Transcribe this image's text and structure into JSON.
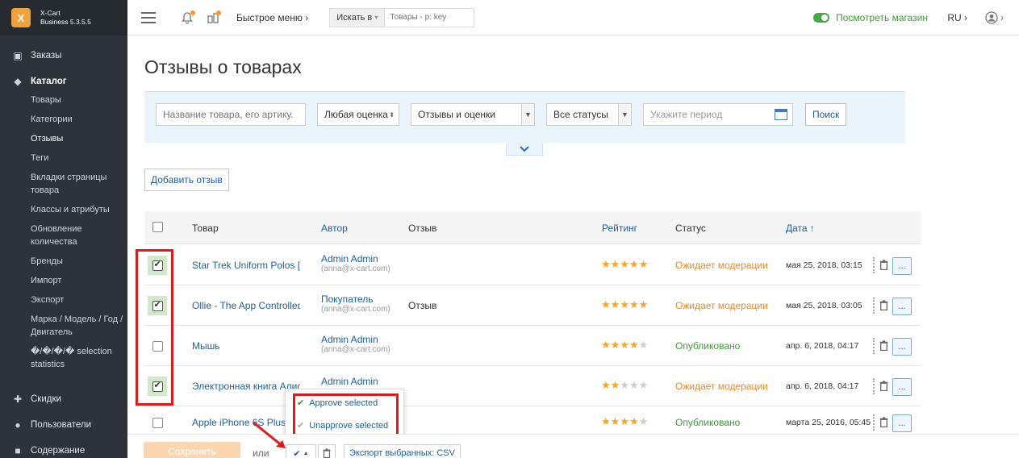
{
  "brand": {
    "logo_glyph": "X",
    "line1": "X-Cart",
    "line2": "Business 5.3.5.5"
  },
  "sidebar": {
    "orders": "Заказы",
    "catalog": "Каталог",
    "catalog_items": [
      "Товары",
      "Категории",
      "Отзывы",
      "Теги",
      "Вкладки страницы товара",
      "Классы и атрибуты",
      "Обновление количества",
      "Бренды",
      "Импорт",
      "Экспорт",
      "Марка / Модель / Год / Двигатель",
      "�/�/�/� selection statistics"
    ],
    "discounts": "Скидки",
    "users": "Пользователи",
    "content": "Содержание"
  },
  "header": {
    "quick_menu": "Быстрое меню",
    "search_in": "Искать в",
    "search_placeholder": "Товары - p: key",
    "view_store": "Посмотреть магазин",
    "lang": "RU"
  },
  "page": {
    "title": "Отзывы о товарах"
  },
  "filters": {
    "product_placeholder": "Название товара, его артику.",
    "rating": "Любая оценка",
    "type": "Отзывы и оценки",
    "status": "Все статусы",
    "period_placeholder": "Укажите период",
    "search_btn": "Поиск"
  },
  "add_review": "Добавить отзыв",
  "table": {
    "headers": {
      "product": "Товар",
      "author": "Автор",
      "review": "Отзыв",
      "rating": "Рейтинг",
      "status": "Статус",
      "date": "Дата ↑"
    },
    "rows": [
      {
        "checked": true,
        "product": "Star Trek Uniform Polos [",
        "author": "Admin Admin",
        "email": "(anna@x-cart.com)",
        "review": "",
        "rating": 5,
        "status": "Ожидает модерации",
        "status_kind": "pending",
        "date": "мая 25, 2018, 03:15"
      },
      {
        "checked": true,
        "product": "Ollie - The App Controlled",
        "author": "Покупатель",
        "email": "(anna@x-cart.com)",
        "review": "Отзыв",
        "rating": 5,
        "status": "Ожидает модерации",
        "status_kind": "pending",
        "date": "мая 25, 2018, 03:05"
      },
      {
        "checked": false,
        "product": "Мышь",
        "author": "Admin Admin",
        "email": "(anna@x-cart.com)",
        "review": "",
        "rating": 4,
        "status": "Опубликовано",
        "status_kind": "published",
        "date": "апр. 6, 2018, 04:17"
      },
      {
        "checked": true,
        "product": "Электронная книга Алис",
        "author": "Admin Admin",
        "email": "",
        "review": "",
        "rating": 2,
        "status": "Ожидает модерации",
        "status_kind": "pending",
        "date": "апр. 6, 2018, 04:17"
      },
      {
        "checked": false,
        "product": "Apple iPhone 6S Plus [",
        "author": "",
        "email": "",
        "review": "",
        "rating": 4,
        "status": "Опубликовано",
        "status_kind": "published",
        "date": "марта 25, 2016, 05:45"
      }
    ],
    "more_label": "..."
  },
  "dropdown": {
    "approve": "Approve selected",
    "unapprove": "Unapprove selected"
  },
  "bottom": {
    "save": "Сохранить",
    "or": "или",
    "export": "Экспорт выбранных: CSV"
  },
  "colors": {
    "accent_blue": "#1d5fa3",
    "pending_orange": "#e9892b",
    "published_green": "#3f9a38",
    "highlight_red": "#e01a1a",
    "star_gold": "#f5a623"
  }
}
